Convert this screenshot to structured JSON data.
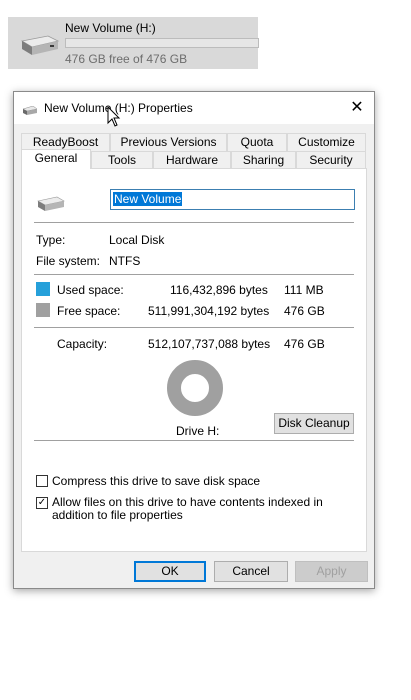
{
  "drive_tile": {
    "name": "New Volume (H:)",
    "free_text": "476 GB free of 476 GB",
    "used_fraction": 0.0,
    "icon": "drive-icon"
  },
  "dialog": {
    "title": "New Volume (H:) Properties",
    "close_glyph": "✕",
    "tabs_back": [
      "ReadyBoost",
      "Previous Versions",
      "Quota",
      "Customize"
    ],
    "tabs_front": [
      "General",
      "Tools",
      "Hardware",
      "Sharing",
      "Security"
    ],
    "active_tab": "General",
    "volume_name": "New Volume",
    "type_label": "Type:",
    "type_value": "Local Disk",
    "fs_label": "File system:",
    "fs_value": "NTFS",
    "used_label": "Used space:",
    "used_bytes": "116,432,896 bytes",
    "used_size": "111 MB",
    "free_label": "Free space:",
    "free_bytes": "511,991,304,192 bytes",
    "free_size": "476 GB",
    "capacity_label": "Capacity:",
    "capacity_bytes": "512,107,737,088 bytes",
    "capacity_size": "476 GB",
    "drive_label": "Drive H:",
    "disk_cleanup": "Disk Cleanup",
    "compress_label": "Compress this drive to save disk space",
    "compress_checked": false,
    "index_label": "Allow files on this drive to have contents indexed in addition to file properties",
    "index_checked": true,
    "check_glyph": "✓",
    "ok": "OK",
    "cancel": "Cancel",
    "apply": "Apply",
    "used_color": "#26a0da",
    "free_color": "#a0a0a0"
  }
}
